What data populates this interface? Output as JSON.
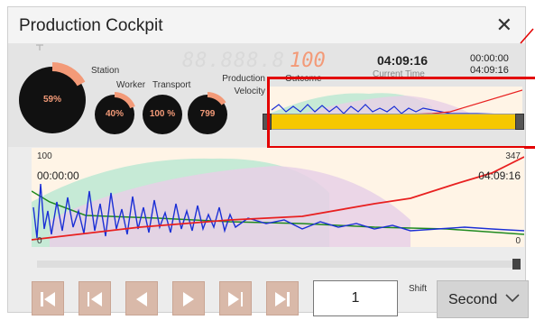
{
  "window": {
    "title": "Production Cockpit",
    "close_label": "✕"
  },
  "gauges": [
    {
      "id": "station",
      "label": "Station",
      "value_text": "59%",
      "fraction": 0.59
    },
    {
      "id": "worker",
      "label": "Worker",
      "value_text": "40%",
      "fraction": 0.4
    },
    {
      "id": "transport",
      "label": "Transport",
      "value_text": "100 %",
      "fraction": 1.0
    },
    {
      "id": "velocity",
      "label": "Production Velocity",
      "value_text": "799",
      "fraction": 0.3
    }
  ],
  "outcome": {
    "label": "Outcome",
    "ghost_digits": "88.888.8",
    "value": "100"
  },
  "current_time": {
    "label": "Current Time",
    "value": "04:09:16"
  },
  "timeline": {
    "start": "00:00:00",
    "end": "04:09:16"
  },
  "main_chart": {
    "y_top_left": "100",
    "y_top_right": "347",
    "y_bottom_left": "0",
    "y_bottom_right": "0",
    "start_time": "00:00:00",
    "end_time": "04:09:16"
  },
  "controls": {
    "frame_value": "1",
    "shift_label": "Shift",
    "unit_selected": "Second",
    "buttons": [
      "first",
      "previous",
      "back",
      "play",
      "next",
      "last"
    ]
  },
  "colors": {
    "accent": "#f39a78",
    "slider": "#f5c800",
    "highlight": "#e30000",
    "series_blue": "#1b2fd6",
    "series_red": "#e82020",
    "series_green": "#1f8a1f"
  }
}
